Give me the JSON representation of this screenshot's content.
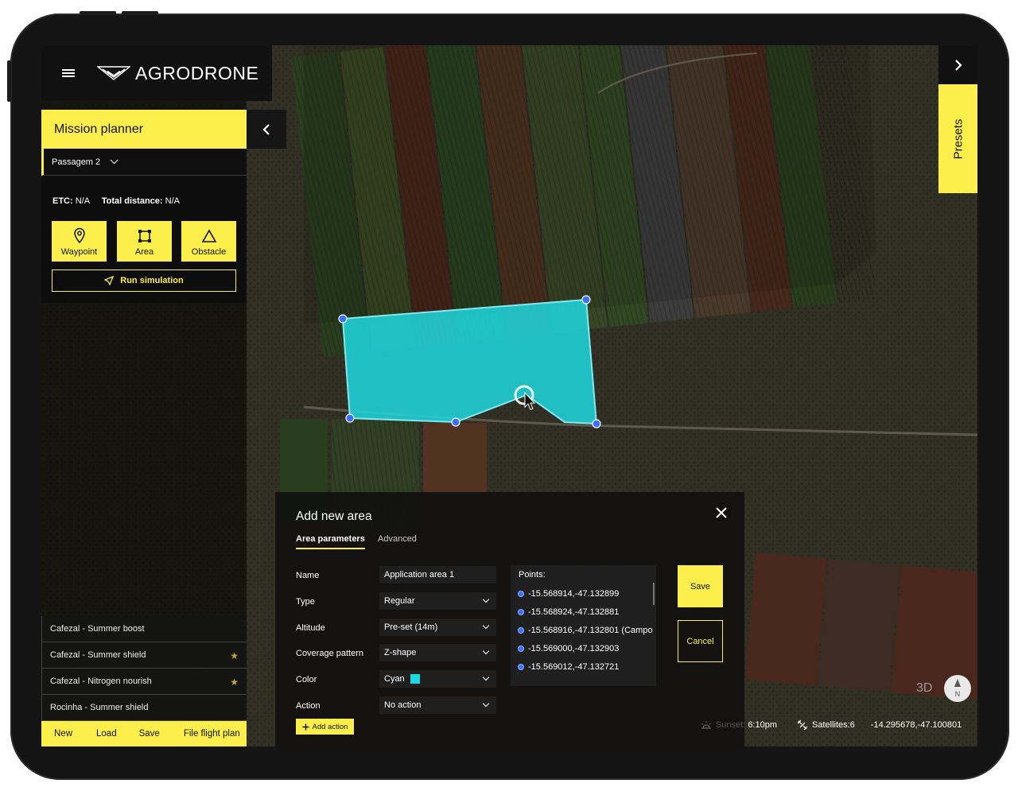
{
  "app": {
    "brand": "AGRODRONE"
  },
  "panel": {
    "title": "Mission planner",
    "mission_name": "Passagem 2",
    "etc_label": "ETC:",
    "etc_value": "N/A",
    "distance_label": "Total distance:",
    "distance_value": "N/A",
    "tools": [
      {
        "label": "Waypoint",
        "icon": "map-pin-icon"
      },
      {
        "label": "Area",
        "icon": "area-square-icon"
      },
      {
        "label": "Obstacle",
        "icon": "triangle-icon"
      }
    ],
    "run_simulation": "Run simulation",
    "presets": [
      {
        "label": "Cafezal - Summer boost",
        "starred": false
      },
      {
        "label": "Cafezal - Summer shield",
        "starred": true
      },
      {
        "label": "Cafezal - Nitrogen nourish",
        "starred": true
      },
      {
        "label": "Rocinha - Summer shield",
        "starred": false
      }
    ],
    "bottom_actions": [
      "New",
      "Load",
      "Save",
      "File flight plan"
    ]
  },
  "presets_tab": "Presets",
  "dialog": {
    "title": "Add new area",
    "tabs": [
      "Area parameters",
      "Advanced"
    ],
    "fields": {
      "name_label": "Name",
      "name_value": "Application area 1",
      "type_label": "Type",
      "type_value": "Regular",
      "altitude_label": "Altitude",
      "altitude_value": "Pre-set (14m)",
      "coverage_label": "Coverage pattern",
      "coverage_value": "Z-shape",
      "color_label": "Color",
      "color_value": "Cyan",
      "color_hex": "#1ed8e0",
      "action_label": "Action",
      "action_value": "No action"
    },
    "add_action": "Add action",
    "points_title": "Points:",
    "points": [
      "-15.568914,-47.132899",
      "-15.568924,-47.132881",
      "-15.568916,-47.132801 (Campo",
      "-15.569000,-47.132903",
      "-15.569012,-47.132721"
    ],
    "save": "Save",
    "cancel": "Cancel"
  },
  "status": {
    "sunset_label": "Sunset:",
    "sunset_value": "6:10pm",
    "satellites": "Satellites:6",
    "coordinates": "-14.295678,-47.100801"
  },
  "map_controls": {
    "view_3d": "3D",
    "compass_letter": "N"
  },
  "colors": {
    "accent": "#fcef4c",
    "area_fill": "#1ed8e0",
    "vertex": "#3b6fff"
  }
}
